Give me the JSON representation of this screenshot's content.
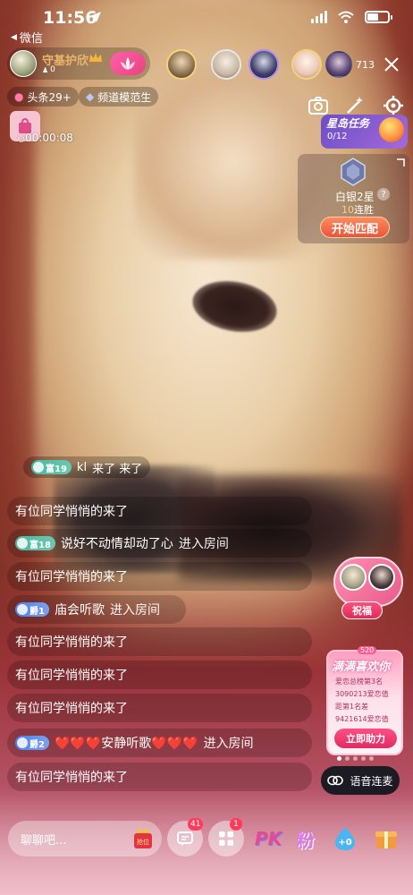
{
  "status_bar": {
    "time": "11:56",
    "battery_level": 0.55
  },
  "back_link": {
    "label": "微信"
  },
  "host": {
    "name": "守基护欣",
    "fans": "0"
  },
  "viewers": {
    "count": "713"
  },
  "tags": {
    "headline": "头条29+",
    "channel": "频道模范生"
  },
  "timer": {
    "label": "心",
    "time": "00:00:08"
  },
  "mission": {
    "title": "星岛任务",
    "progress": "0/12"
  },
  "rank": {
    "name": "白银2星",
    "help": "?",
    "streak_number": "10",
    "streak_label": "连胜",
    "match_button": "开始匹配"
  },
  "chat": {
    "top_message": {
      "level": "富19",
      "user": "kl",
      "text": "来了 来了"
    },
    "messages": [
      {
        "type": "plain",
        "text": "有位同学悄悄的来了"
      },
      {
        "type": "enter",
        "badge": "富18",
        "badge_color": "green",
        "user": "说好不动情却动了心",
        "action": "进入房间"
      },
      {
        "type": "plain",
        "text": "有位同学悄悄的来了"
      },
      {
        "type": "enter",
        "badge": "爵1",
        "badge_color": "blue",
        "user": "庙会听歌",
        "action": "进入房间"
      },
      {
        "type": "plain",
        "text": "有位同学悄悄的来了"
      },
      {
        "type": "plain",
        "text": "有位同学悄悄的来了"
      },
      {
        "type": "plain",
        "text": "有位同学悄悄的来了"
      },
      {
        "type": "enter",
        "badge": "爵2",
        "badge_color": "blue",
        "user": "❤️❤️❤️安静听歌❤️❤️❤️",
        "action": "进入房间"
      },
      {
        "type": "plain",
        "text": "有位同学悄悄的来了"
      }
    ]
  },
  "pk_widget": {
    "button": "祝福"
  },
  "event": {
    "badge": "520",
    "title": "满满喜欢你",
    "lines": [
      "爱恋总榜第3名",
      "3090213爱恋值",
      "距第1名差",
      "9421614爱恋值"
    ],
    "button": "立即助力"
  },
  "voice": {
    "label": "语音连麦"
  },
  "bottom_bar": {
    "input_placeholder": "聊聊吧...",
    "gift_label": "抢位",
    "chat_badge": "41",
    "apps_badge": "1",
    "pk_label": "PK",
    "music_label": "粉",
    "plus_label": "+0"
  },
  "colors": {
    "accent_pink": "#e9437f",
    "level_green": "#49b7a0",
    "level_blue": "#4e7ee6",
    "mission_purple": "#6a4ec9",
    "match_orange": "#e9553d"
  }
}
